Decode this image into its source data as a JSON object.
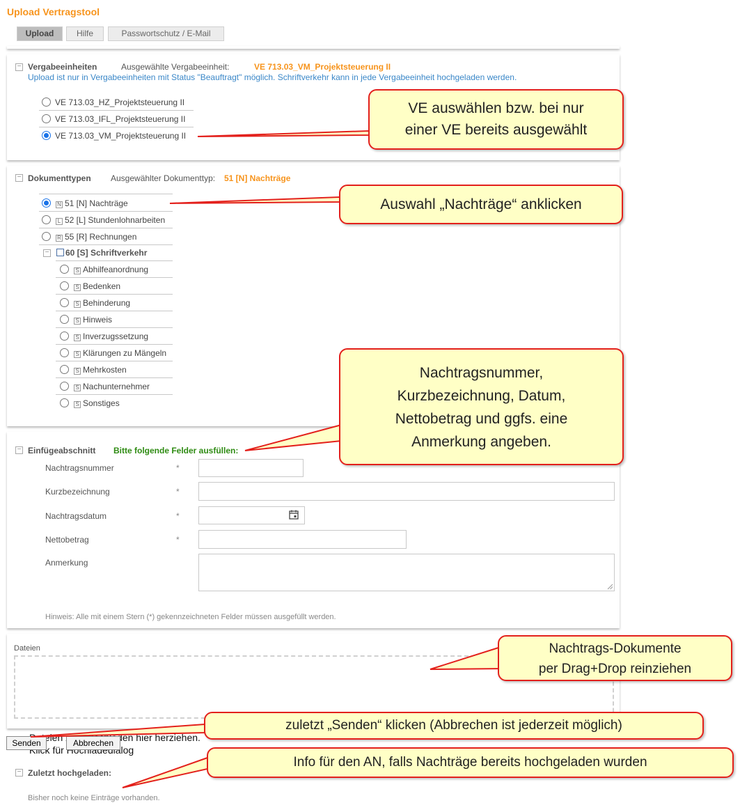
{
  "app_title": "Upload Vertragstool",
  "tabs": [
    {
      "label": "Upload",
      "active": true
    },
    {
      "label": "Hilfe",
      "active": false
    },
    {
      "label": "Passwortschutz / E-Mail",
      "active": false
    }
  ],
  "vergabe": {
    "toggle": "−",
    "title": "Vergabeeinheiten",
    "selected_prefix": "Ausgewählte Vergabeeinheit:",
    "selected_value": "VE 713.03_VM_Projektsteuerung II",
    "note": "Upload ist nur in Vergabeeinheiten mit Status \"Beauftragt\" möglich. Schriftverkehr kann in jede Vergabeeinheit hochgeladen werden.",
    "options": [
      {
        "label": "VE 713.03_HZ_Projektsteuerung II",
        "checked": false
      },
      {
        "label": "VE 713.03_IFL_Projektsteuerung II",
        "checked": false
      },
      {
        "label": "VE 713.03_VM_Projektsteuerung II",
        "checked": true
      }
    ]
  },
  "doktypen": {
    "toggle": "−",
    "title": "Dokumenttypen",
    "selected_prefix": "Ausgewählter Dokumenttyp:",
    "selected_value": "51 [N] Nachträge",
    "options": [
      {
        "badge": "N",
        "label": "51 [N] Nachträge",
        "checked": true
      },
      {
        "badge": "L",
        "label": "52 [L] Stundenlohnarbeiten",
        "checked": false
      },
      {
        "badge": "R",
        "label": "55 [R] Rechnungen",
        "checked": false
      }
    ],
    "group": {
      "toggle": "−",
      "label": "60 [S] Schriftverkehr"
    },
    "sub_options": [
      {
        "badge": "S",
        "label": "Abhilfeanordnung"
      },
      {
        "badge": "S",
        "label": "Bedenken"
      },
      {
        "badge": "S",
        "label": "Behinderung"
      },
      {
        "badge": "S",
        "label": "Hinweis"
      },
      {
        "badge": "S",
        "label": "Inverzugssetzung"
      },
      {
        "badge": "S",
        "label": "Klärungen zu Mängeln"
      },
      {
        "badge": "S",
        "label": "Mehrkosten"
      },
      {
        "badge": "S",
        "label": "Nachunternehmer"
      },
      {
        "badge": "S",
        "label": "Sonstiges"
      }
    ]
  },
  "einfuege": {
    "toggle": "−",
    "title": "Einfügeabschnitt",
    "instruction": "Bitte folgende Felder ausfüllen:",
    "fields": [
      {
        "label": "Nachtragsnummer",
        "required": "*"
      },
      {
        "label": "Kurzbezeichnung",
        "required": "*"
      },
      {
        "label": "Nachtragsdatum",
        "required": "*"
      },
      {
        "label": "Nettobetrag",
        "required": "*"
      },
      {
        "label": "Anmerkung",
        "required": ""
      }
    ],
    "hint": "Hinweis: Alle mit einem Stern (*) gekennzeichneten Felder müssen ausgefüllt werden."
  },
  "dateien": {
    "label": "Dateien",
    "drop_line1": "Dateien zum Hochladen hier herziehen.",
    "drop_line2": "Klick für Hochladedialog"
  },
  "buttons": {
    "send": "Senden",
    "cancel": "Abbrechen"
  },
  "zuletzt": {
    "toggle": "−",
    "title": "Zuletzt hochgeladen:",
    "empty": "Bisher noch keine Einträge vorhanden."
  },
  "icons": {
    "calendar": "calendar-icon",
    "resize": "resize-grip-icon"
  },
  "colors": {
    "accent_orange": "#f7941d",
    "note_blue": "#3a87c8",
    "ok_green": "#2e8b12",
    "callout_fill": "#ffffc6",
    "callout_border": "#e3201c",
    "radio_blue": "#1a73e8"
  },
  "callouts": {
    "ve": {
      "line1": "VE auswählen bzw. bei nur",
      "line2": "einer VE bereits ausgewählt"
    },
    "nachtraege": "Auswahl „Nachträge“ anklicken",
    "felder": {
      "line1": "Nachtragsnummer,",
      "line2": "Kurzbezeichnung, Datum,",
      "line3": "Nettobetrag und ggfs. eine",
      "line4": "Anmerkung angeben."
    },
    "dokumente": {
      "line1": "Nachtrags-Dokumente",
      "line2": "per Drag+Drop reinziehen"
    },
    "senden": "zuletzt „Senden“ klicken (Abbrechen ist jederzeit möglich)",
    "info": "Info für den AN, falls Nachträge bereits hochgeladen wurden"
  }
}
